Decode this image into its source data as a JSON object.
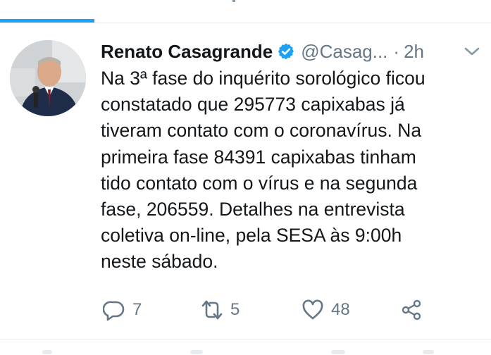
{
  "tweet": {
    "author": {
      "display_name": "Renato Casagrande",
      "handle": "@Casag...",
      "verified": true
    },
    "separator": "·",
    "time": "2h",
    "text_lines": [
      "Na 3ª fase do inquérito sorológico ficou",
      "constatado que 295773 capixabas já",
      "tiveram contato com o coronavírus. Na",
      "primeira fase 84391 capixabas tinham",
      "tido contato com o vírus e na segunda",
      "fase, 206559. Detalhes na entrevista",
      "coletiva on-line, pela SESA às 9:00h",
      "neste sábado."
    ],
    "stats": {
      "replies": "7",
      "retweets": "5",
      "likes": "48"
    }
  },
  "colors": {
    "accent": "#1da1f2",
    "text": "#14171a",
    "secondary": "#657786",
    "divider": "#e6ecf0"
  },
  "icons": {
    "verified": "verified-badge-icon",
    "caret": "chevron-down-icon",
    "reply": "reply-icon",
    "retweet": "retweet-icon",
    "like": "heart-icon",
    "share": "share-icon"
  }
}
